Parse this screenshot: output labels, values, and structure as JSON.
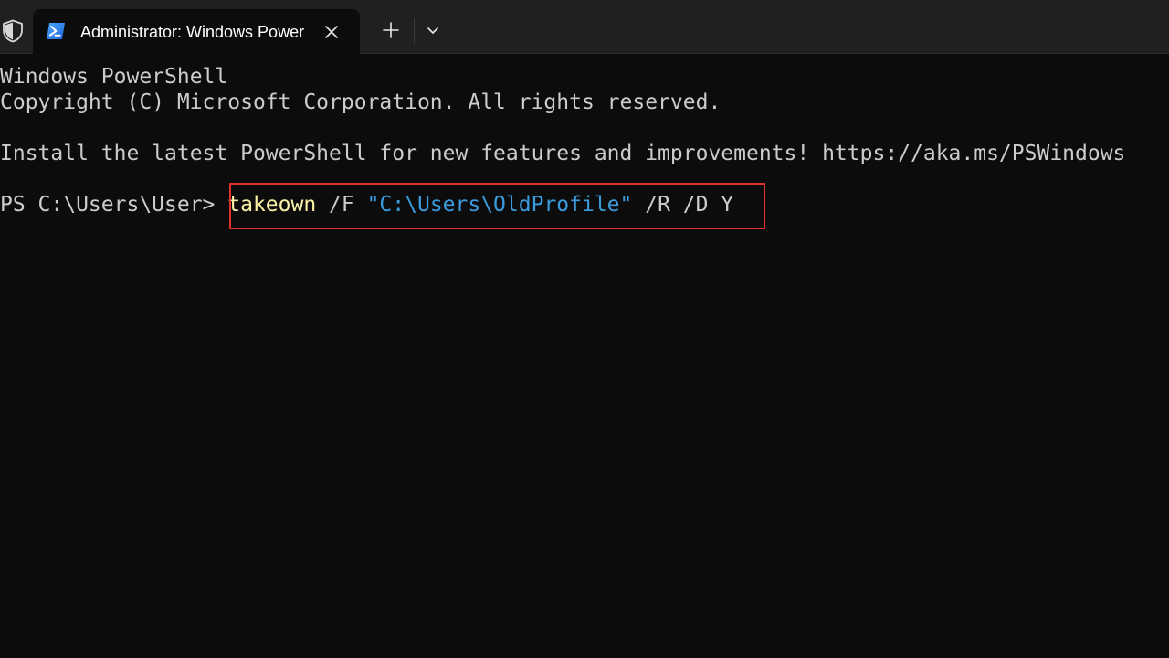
{
  "titlebar": {
    "shield_icon": "shield-icon",
    "tab": {
      "icon": "powershell-icon",
      "title": "Administrator: Windows PowerShell",
      "close_icon": "close-icon"
    },
    "new_tab_icon": "plus-icon",
    "dropdown_icon": "chevron-down-icon"
  },
  "terminal": {
    "lines": [
      "Windows PowerShell",
      "Copyright (C) Microsoft Corporation. All rights reserved.",
      "Install the latest PowerShell for new features and improvements! https://aka.ms/PSWindows"
    ],
    "prompt": "PS C:\\Users\\User> ",
    "command": {
      "name": "takeown",
      "flag_f": " /F ",
      "path": "\"C:\\Users\\OldProfile\"",
      "flags_rest": " /R /D Y"
    },
    "colors": {
      "background": "#0c0c0c",
      "text": "#cccccc",
      "command": "#f9f1a5",
      "string": "#3b9bdc",
      "highlight": "#e0302b"
    }
  }
}
